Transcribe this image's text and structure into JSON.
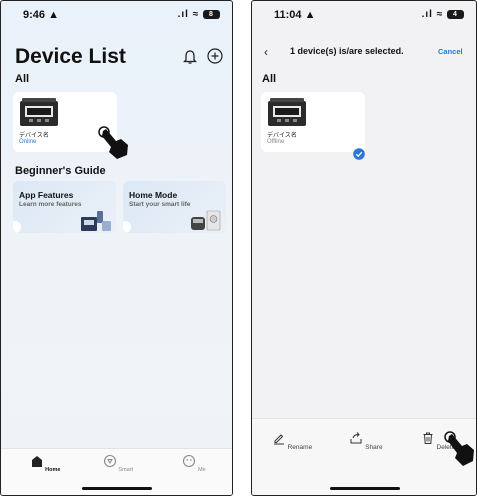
{
  "left_screen": {
    "status_time": "9:46",
    "battery": "8",
    "title": "Device List",
    "section_all": "All",
    "device": {
      "name": "デバイス名",
      "status": "Online"
    },
    "section_guide": "Beginner's Guide",
    "guides": [
      {
        "title": "App Features",
        "subtitle": "Learn more features"
      },
      {
        "title": "Home Mode",
        "subtitle": "Start your smart life"
      }
    ],
    "tabs": [
      {
        "label": "Home",
        "icon": "home-icon",
        "active": true
      },
      {
        "label": "Smart",
        "icon": "smart-icon",
        "active": false
      },
      {
        "label": "Me",
        "icon": "me-icon",
        "active": false
      }
    ]
  },
  "right_screen": {
    "status_time": "11:04",
    "battery": "4",
    "nav_title": "1 device(s) is/are selected.",
    "cancel": "Cancel",
    "section_all": "All",
    "device": {
      "name": "デバイス名",
      "status": "Offline",
      "selected": true
    },
    "actions": [
      {
        "label": "Rename",
        "icon": "rename-icon"
      },
      {
        "label": "Share",
        "icon": "share-icon"
      },
      {
        "label": "Delete",
        "icon": "trash-icon"
      }
    ]
  },
  "colors": {
    "accent": "#2a78d6",
    "text": "#111111",
    "muted": "#888888"
  }
}
